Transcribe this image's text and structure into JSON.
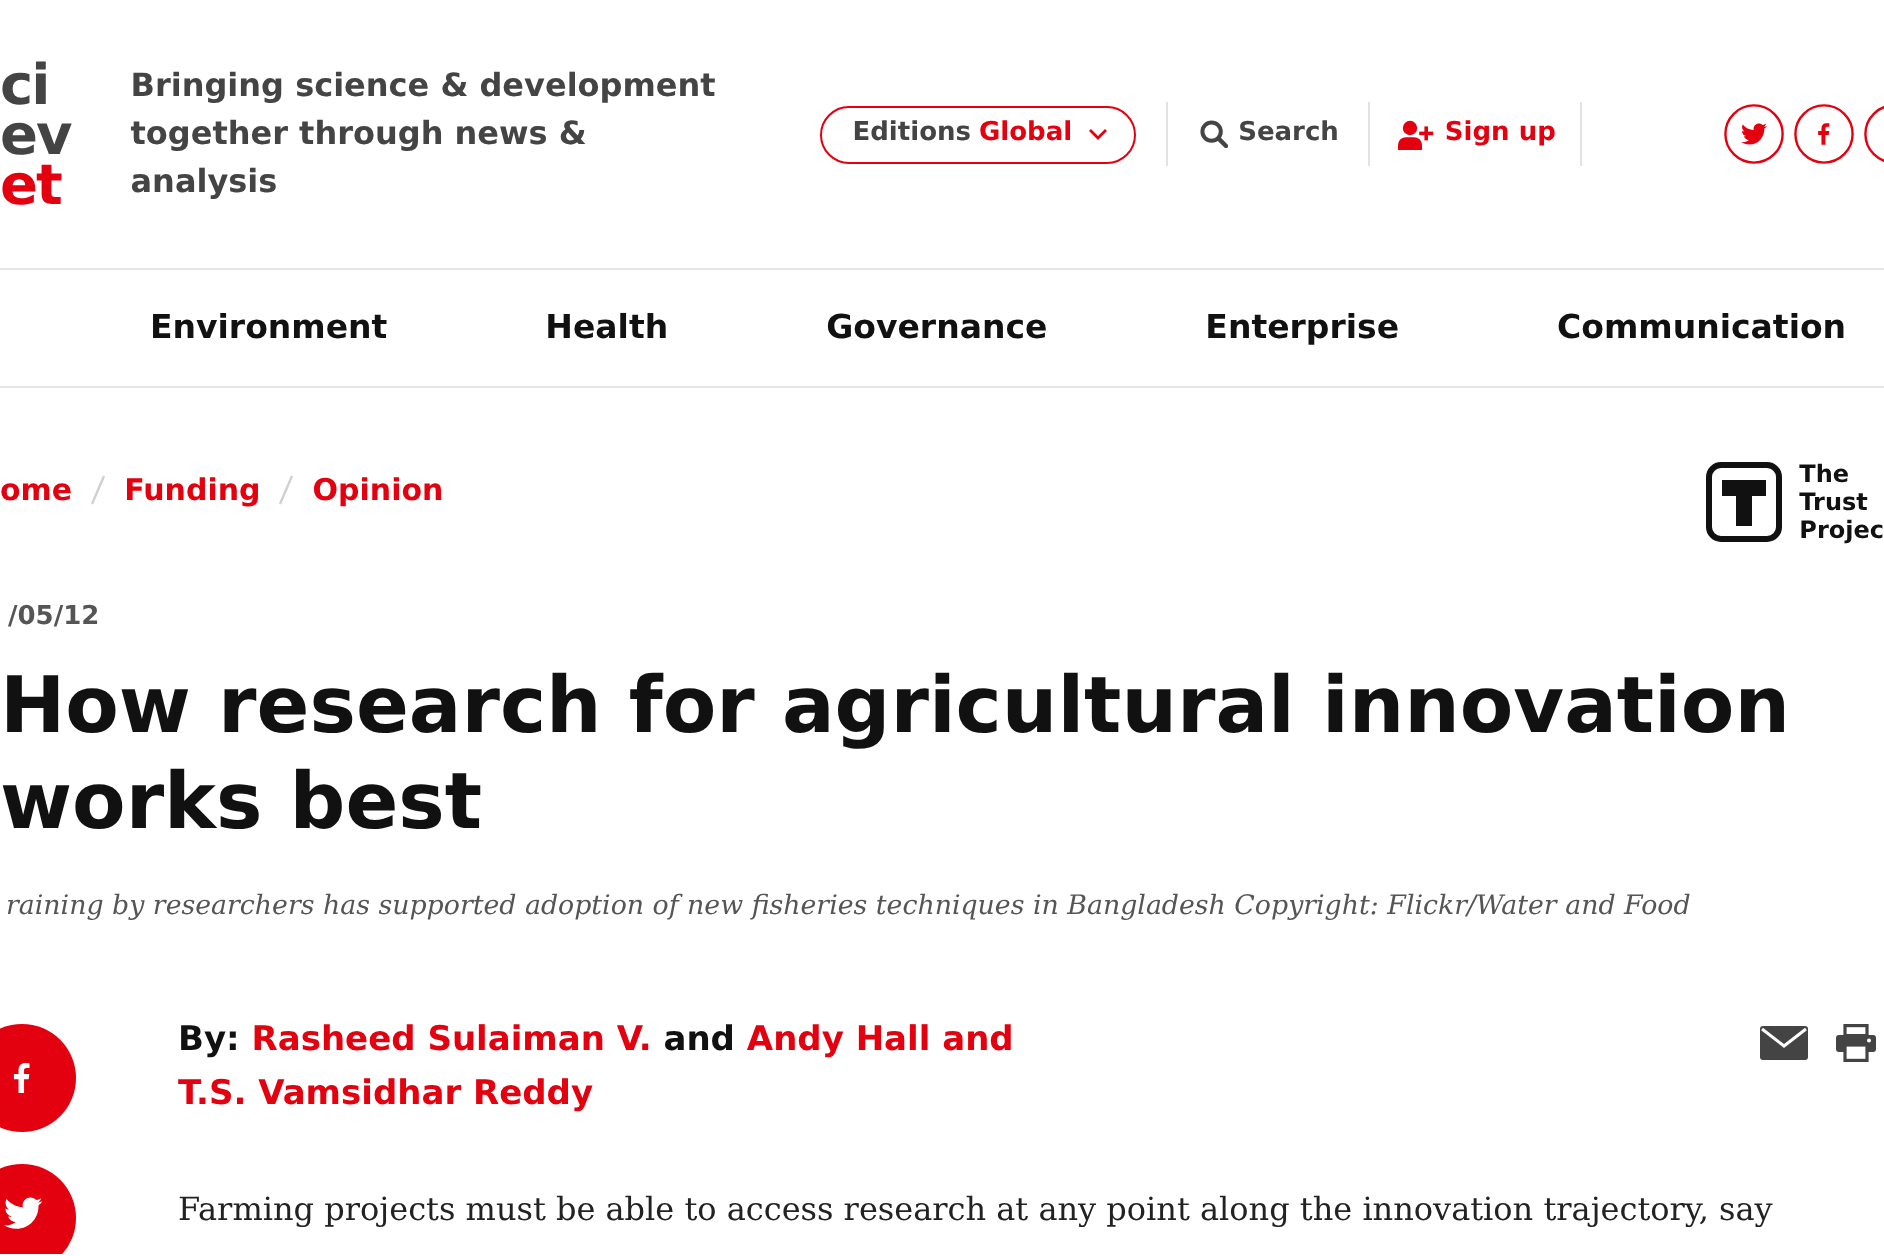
{
  "header": {
    "logo": [
      {
        "text": "ci",
        "color": "#444444"
      },
      {
        "text": "ev",
        "color": "#444444"
      },
      {
        "text": "et",
        "color": "#e3000f"
      }
    ],
    "tagline": "Bringing science & development together through news & analysis",
    "editions": {
      "label": "Editions",
      "value": "Global"
    },
    "search": {
      "label": "Search"
    },
    "signup": {
      "label": "Sign up"
    }
  },
  "nav": [
    {
      "label": "Environment"
    },
    {
      "label": "Health"
    },
    {
      "label": "Governance"
    },
    {
      "label": "Enterprise"
    },
    {
      "label": "Communication"
    }
  ],
  "breadcrumb": [
    {
      "label": "ome"
    },
    {
      "label": "Funding"
    },
    {
      "label": "Opinion"
    }
  ],
  "trust_badge": {
    "label": "The Trust Projec"
  },
  "article": {
    "date": "/05/12",
    "title": "How research for agricultural innovation works best",
    "caption": "raining by researchers has supported adoption of new fisheries techniques in Bangladesh Copyright: Flickr/Water and Food",
    "byline": [
      {
        "kind": "label",
        "text": "By:"
      },
      {
        "kind": "author",
        "text": "Rasheed Sulaiman V."
      },
      {
        "kind": "plain",
        "text": "and"
      },
      {
        "kind": "author",
        "text": "Andy Hall and"
      },
      {
        "kind": "author",
        "text": "T.S. Vamsidhar Reddy"
      }
    ],
    "body": "Farming projects must be able to access research at any point along the innovation trajectory, say"
  }
}
